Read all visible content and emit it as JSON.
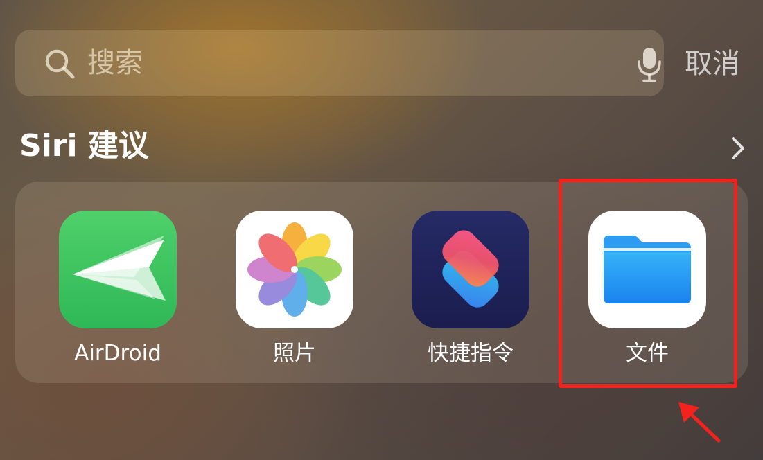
{
  "search": {
    "placeholder": "搜索",
    "cancel_label": "取消"
  },
  "section": {
    "title": "Siri 建议"
  },
  "apps": [
    {
      "label": "AirDroid",
      "icon": "airdroid-icon"
    },
    {
      "label": "照片",
      "icon": "photos-icon"
    },
    {
      "label": "快捷指令",
      "icon": "shortcuts-icon"
    },
    {
      "label": "文件",
      "icon": "files-icon"
    }
  ],
  "colors": {
    "highlight": "#f4221d",
    "airdroid_green": "#3cc260",
    "files_blue": "#1d8ff1",
    "shortcuts_navy": "#1f2259"
  }
}
